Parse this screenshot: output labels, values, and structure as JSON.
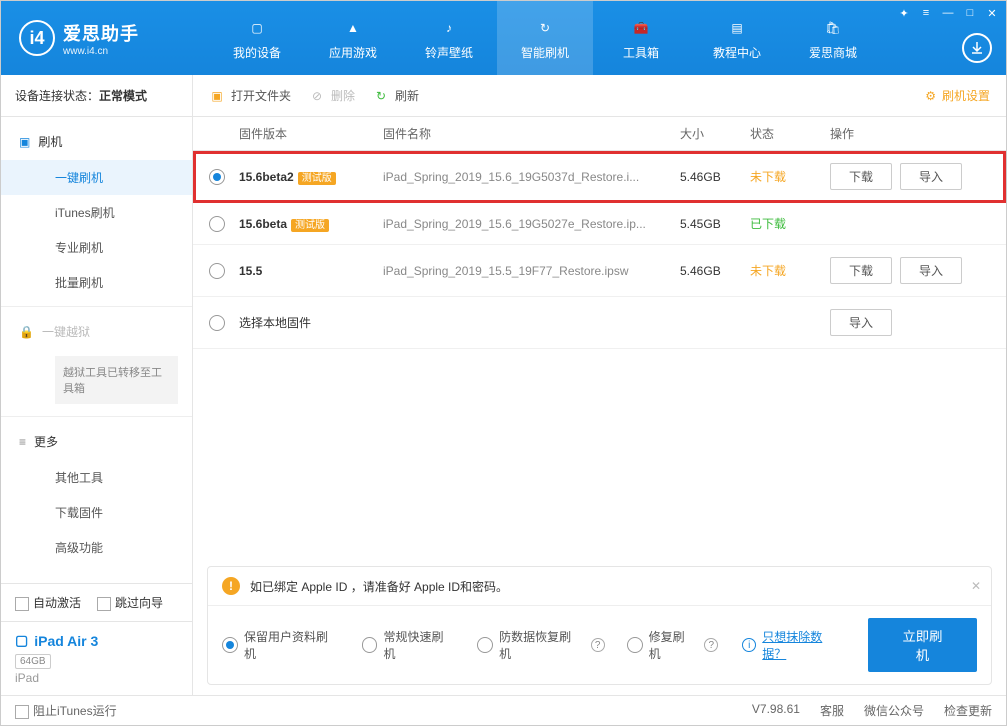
{
  "app": {
    "title": "爱思助手",
    "site": "www.i4.cn"
  },
  "nav": [
    {
      "label": "我的设备"
    },
    {
      "label": "应用游戏"
    },
    {
      "label": "铃声壁纸"
    },
    {
      "label": "智能刷机",
      "active": true
    },
    {
      "label": "工具箱"
    },
    {
      "label": "教程中心"
    },
    {
      "label": "爱思商城"
    }
  ],
  "sidebar": {
    "status_label": "设备连接状态：",
    "status_value": "正常模式",
    "flash_head": "刷机",
    "flash_items": [
      "一键刷机",
      "iTunes刷机",
      "专业刷机",
      "批量刷机"
    ],
    "jailbreak_head": "一键越狱",
    "jailbreak_note": "越狱工具已转移至工具箱",
    "more_head": "更多",
    "more_items": [
      "其他工具",
      "下载固件",
      "高级功能"
    ],
    "auto_activate": "自动激活",
    "skip_guide": "跳过向导"
  },
  "device": {
    "name": "iPad Air 3",
    "storage": "64GB",
    "type": "iPad"
  },
  "toolbar": {
    "open": "打开文件夹",
    "delete": "删除",
    "refresh": "刷新",
    "settings": "刷机设置"
  },
  "table": {
    "headers": {
      "version": "固件版本",
      "name": "固件名称",
      "size": "大小",
      "status": "状态",
      "ops": "操作"
    },
    "beta_tag": "测试版",
    "btn_download": "下载",
    "btn_import": "导入",
    "local_label": "选择本地固件",
    "rows": [
      {
        "version": "15.6beta2",
        "beta": true,
        "name": "iPad_Spring_2019_15.6_19G5037d_Restore.i...",
        "size": "5.46GB",
        "status": "未下载",
        "status_cls": "nodl",
        "selected": true,
        "highlight": true,
        "ops": [
          "download",
          "import"
        ]
      },
      {
        "version": "15.6beta",
        "beta": true,
        "name": "iPad_Spring_2019_15.6_19G5027e_Restore.ip...",
        "size": "5.45GB",
        "status": "已下载",
        "status_cls": "dl",
        "selected": false,
        "ops": []
      },
      {
        "version": "15.5",
        "beta": false,
        "name": "iPad_Spring_2019_15.5_19F77_Restore.ipsw",
        "size": "5.46GB",
        "status": "未下载",
        "status_cls": "nodl",
        "selected": false,
        "ops": [
          "download",
          "import"
        ]
      }
    ]
  },
  "notice": {
    "text": "如已绑定 Apple ID ，请准备好 Apple ID和密码。",
    "opts": [
      "保留用户资料刷机",
      "常规快速刷机",
      "防数据恢复刷机",
      "修复刷机"
    ],
    "erase_link": "只想抹除数据？",
    "flash_btn": "立即刷机"
  },
  "footer": {
    "block_itunes": "阻止iTunes运行",
    "version": "V7.98.61",
    "support": "客服",
    "wechat": "微信公众号",
    "update": "检查更新"
  }
}
